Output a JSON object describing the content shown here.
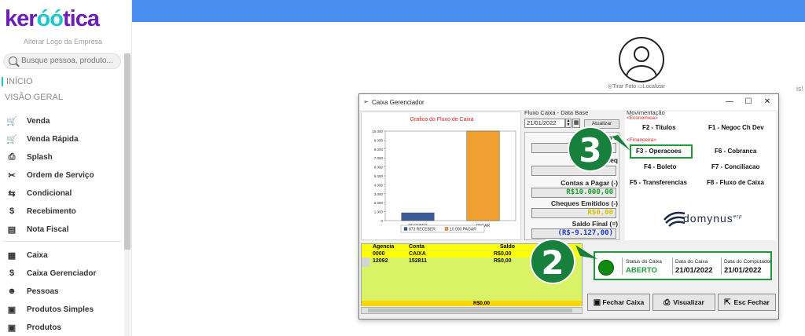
{
  "logo": {
    "pre": "ker",
    "mid": "óó",
    "post": "tica",
    "alt_text": "Alterar Logo da Empresa"
  },
  "search": {
    "placeholder": "Busque pessoa, produto..."
  },
  "nav": {
    "inicio": "INÍCIO",
    "visao_geral": "VISÃO GERAL"
  },
  "menu": {
    "group1": [
      {
        "label": "Venda",
        "icon": "cart-icon"
      },
      {
        "label": "Venda Rápida",
        "icon": "cart-fast-icon"
      },
      {
        "label": "Splash",
        "icon": "splash-icon"
      },
      {
        "label": "Ordem de Serviço",
        "icon": "wrench-icon"
      },
      {
        "label": "Condicional",
        "icon": "cart-conditional-icon"
      },
      {
        "label": "Recebimento",
        "icon": "hand-money-icon"
      },
      {
        "label": "Nota Fiscal",
        "icon": "invoice-icon"
      }
    ],
    "group2": [
      {
        "label": "Caixa",
        "icon": "register-icon"
      },
      {
        "label": "Caixa Gerenciador",
        "icon": "money-manager-icon"
      },
      {
        "label": "Pessoas",
        "icon": "people-icon"
      },
      {
        "label": "Produtos Simples",
        "icon": "box-icon"
      },
      {
        "label": "Produtos",
        "icon": "box-icon"
      }
    ]
  },
  "profile": {
    "tirar_foto": "Tirar Foto",
    "localizar": "Localizar",
    "truncated": "is!"
  },
  "window": {
    "title": "Caixa Gerenciador",
    "controls": {
      "minimize": "—",
      "maximize": "☐",
      "close": "✕"
    },
    "chart_title": "Grafico do Fluxo de Caixa",
    "fluxo": {
      "label": "Fluxo Caixa - Data Base",
      "date": "21/01/2022",
      "atualizar": "Atualizar",
      "contas_receber": "Contas a",
      "cheques_receber": "Cheq",
      "contas_pagar": "Contas a Pagar (-)",
      "contas_pagar_val": "R$10.000,00",
      "cheques_emitidos": "Cheques Emitidos (-)",
      "cheques_emitidos_val": "R$0,00",
      "saldo_final": "Saldo Final (=)",
      "saldo_final_val": "(R$-9.127,00)"
    },
    "movimentacao": {
      "label": "Movimentação",
      "economica": "<Economica>",
      "financeira": "<Financeira>",
      "buttons": {
        "f2": "F2 - Titulos",
        "f1": "F1 - Negoc Ch Dev",
        "f3": "F3 - Operacoes",
        "f6": "F6 - Cobranca",
        "f4": "F4 - Boleto",
        "f7": "F7 - Conciliacao",
        "f5": "F5 - Transferencias",
        "f8": "F8 - Fluxo de Caixa"
      },
      "brand": "domynus",
      "brand_sup": "erp"
    },
    "grid": {
      "headers": [
        "Agencia",
        "Conta",
        "Saldo"
      ],
      "rows": [
        [
          "0000",
          "CAIXA",
          "R$0,00"
        ],
        [
          "12092",
          "152811",
          "R$0,00"
        ]
      ],
      "total": "R$0,00"
    },
    "status": {
      "status_label": "Status do Caixa",
      "status_value": "ABERTO",
      "data_caixa_label": "Data do Caixa",
      "data_caixa_value": "21/01/2022",
      "data_computador_label": "Data do Computador",
      "data_computador_value": "21/01/2022"
    },
    "buttons": {
      "fechar": "Fechar Caixa",
      "fechar_key": "F",
      "visualizar": "Visualizar",
      "esc": "Esc Fechar"
    }
  },
  "callouts": {
    "one": "3",
    "two": "2"
  },
  "colors": {
    "brand_purple": "#6b1fb8",
    "brand_teal": "#1ec8c8",
    "topbar": "#4a8ef0",
    "callout_green": "#17803c",
    "bar_receber": "#3a5a9a",
    "bar_pagar": "#f0a030"
  },
  "chart_data": {
    "type": "bar",
    "title": "Grafico do Fluxo de Caixa",
    "categories": [
      "RECEBER",
      "PAGAR"
    ],
    "values": [
      873,
      10000
    ],
    "ylim": [
      0,
      10000
    ],
    "yticks": [
      "0",
      "1.000",
      "2.000",
      "3.000",
      "4.000",
      "5.000",
      "6.000",
      "7.000",
      "8.000",
      "9.000",
      "10.000"
    ],
    "legend": [
      "873 RECEBER",
      "10.000 PAGAR"
    ],
    "colors": [
      "#3a5a9a",
      "#f0a030"
    ]
  }
}
